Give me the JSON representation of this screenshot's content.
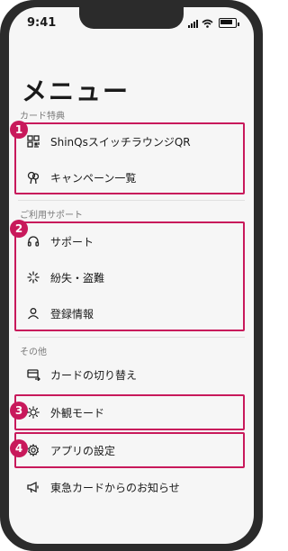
{
  "status": {
    "time": "9:41"
  },
  "page_title": "メニュー",
  "sections": {
    "card_benefits": {
      "label": "カード特典",
      "items": [
        "ShinQsスイッチラウンジQR",
        "キャンペーン一覧"
      ]
    },
    "contract": {
      "label": "ご利用サポート",
      "items": [
        "サポート",
        "紛失・盗難",
        "登録情報"
      ]
    },
    "other": {
      "label": "その他",
      "items": [
        "カードの切り替え",
        "外観モード",
        "アプリの設定",
        "東急カードからのお知らせ"
      ]
    }
  },
  "badges": [
    "1",
    "2",
    "3",
    "4"
  ],
  "colors": {
    "highlight": "#c8195b",
    "background": "#f6f6f6",
    "frame": "#2b2b2b"
  },
  "icons": {
    "qr": "qr-code-icon",
    "campaign": "balloon-icon",
    "support": "headset-icon",
    "lost": "spark-icon",
    "account": "person-icon",
    "switch_card": "card-switch-icon",
    "appearance": "sun-icon",
    "settings": "gear-icon",
    "notice": "megaphone-icon"
  }
}
